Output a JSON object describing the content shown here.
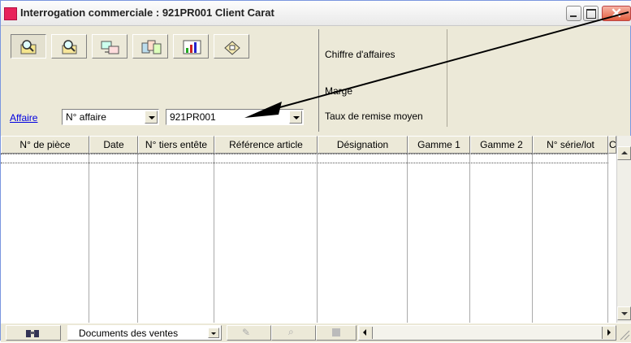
{
  "window": {
    "title": "Interrogation commerciale : 921PR001 Client Carat"
  },
  "toolbar": {
    "buttons": [
      {
        "name": "search-sheet-icon"
      },
      {
        "name": "search-magnify-icon"
      },
      {
        "name": "exchange-icon"
      },
      {
        "name": "multi-document-icon"
      },
      {
        "name": "chart-icon"
      },
      {
        "name": "stamp-icon"
      }
    ]
  },
  "filter": {
    "link_label": "Affaire",
    "field_value": "N° affaire",
    "affair_value": "921PR001"
  },
  "summary": {
    "labels": [
      "Chiffre d'affaires",
      "Marge",
      "Taux de remise moyen"
    ]
  },
  "table": {
    "columns": [
      "N° de pièce",
      "Date",
      "N° tiers entête",
      "Référence article",
      "Désignation",
      "Gamme 1",
      "Gamme 2",
      "N° série/lot",
      "C"
    ]
  },
  "statusbar": {
    "view_label": "Documents des ventes"
  },
  "colors": {
    "accent": "#e8235a",
    "link": "#0000e0",
    "chrome": "#ece9d8"
  }
}
